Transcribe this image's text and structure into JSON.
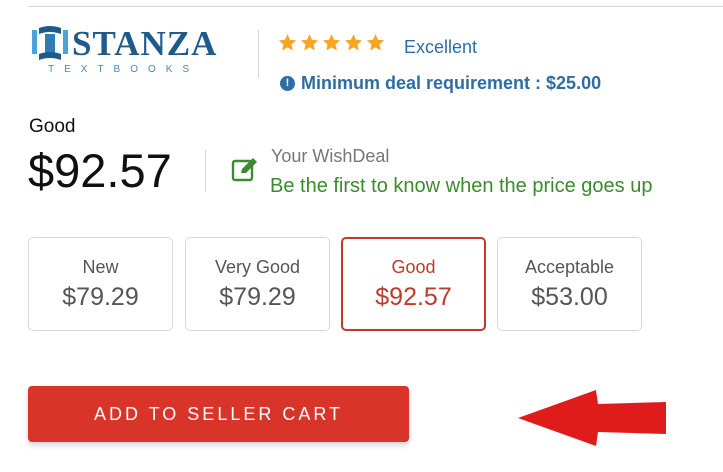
{
  "seller": {
    "logo_name": "STANZA",
    "logo_tagline": "TEXTBOOKS",
    "rating_stars": 5,
    "rating_label": "Excellent",
    "min_deal_text": "Minimum deal requirement : $25.00"
  },
  "price": {
    "condition_label": "Good",
    "amount": "$92.57"
  },
  "wishdeal": {
    "title": "Your WishDeal",
    "subtitle": "Be the first to know when the price goes up"
  },
  "conditions": [
    {
      "name": "New",
      "price": "$79.29",
      "selected": false
    },
    {
      "name": "Very Good",
      "price": "$79.29",
      "selected": false
    },
    {
      "name": "Good",
      "price": "$92.57",
      "selected": true
    },
    {
      "name": "Acceptable",
      "price": "$53.00",
      "selected": false
    }
  ],
  "cart": {
    "button_label": "ADD TO SELLER CART"
  },
  "colors": {
    "brand_blue": "#1e5a8a",
    "link_blue": "#2e6da4",
    "star_orange": "#f5a623",
    "wish_green": "#3c8a2e",
    "selected_red": "#c0392b",
    "button_red": "#d9342a",
    "arrow_red": "#e01b1b"
  },
  "icons": {
    "logo": "book-column-icon",
    "rating": "star-icon",
    "info": "info-circle-icon",
    "wishdeal": "edit-note-icon",
    "pointer": "left-arrow-icon"
  }
}
